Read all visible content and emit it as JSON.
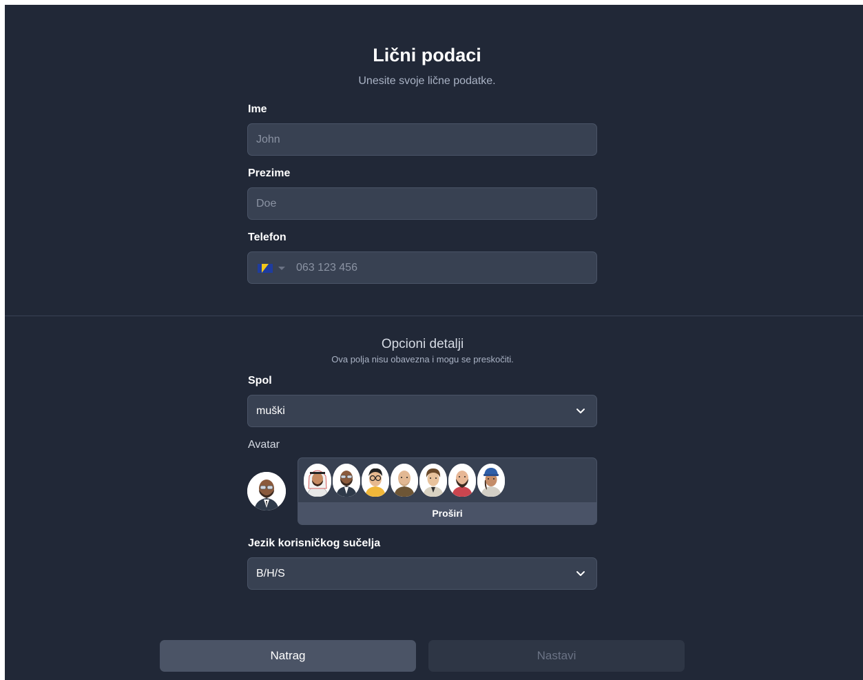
{
  "header": {
    "title": "Lični podaci",
    "subtitle": "Unesite svoje lične podatke."
  },
  "fields": {
    "first_name": {
      "label": "Ime",
      "placeholder": "John"
    },
    "last_name": {
      "label": "Prezime",
      "placeholder": "Doe"
    },
    "phone": {
      "label": "Telefon",
      "placeholder": "063 123 456",
      "country_flag": "bosnia-herzegovina-flag"
    }
  },
  "optional": {
    "title": "Opcioni detalji",
    "subtitle": "Ova polja nisu obavezna i mogu se preskočiti.",
    "gender": {
      "label": "Spol",
      "value": "muški"
    },
    "avatar": {
      "label": "Avatar",
      "expand_label": "Proširi",
      "options": [
        "avatar-keffiyeh",
        "avatar-bald-glasses-beard",
        "avatar-glasses-yellow-shirt",
        "avatar-bald-brown-jacket",
        "avatar-curly-hair",
        "avatar-bald-red-beard",
        "avatar-blue-cap"
      ]
    },
    "language": {
      "label": "Jezik korisničkog sučelja",
      "value": "B/H/S"
    }
  },
  "actions": {
    "back_label": "Natrag",
    "next_label": "Nastavi"
  },
  "colors": {
    "background": "#212837",
    "field": "#384152",
    "button_back": "#4b5466",
    "button_next_disabled": "#2e3645"
  }
}
